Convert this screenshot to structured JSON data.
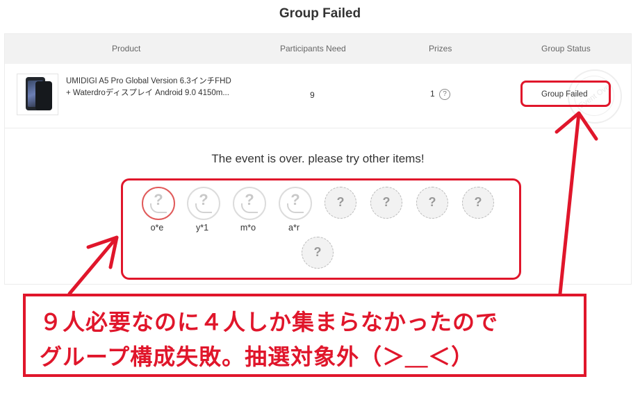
{
  "page": {
    "title": "Group Failed"
  },
  "table": {
    "headers": [
      "Product",
      "Participants Need",
      "Prizes",
      "Group Status"
    ],
    "row": {
      "product_line1": "UMIDIGI A5 Pro Global Version 6.3インチFHD",
      "product_line2": "+ Waterdroディスプレイ Android 9.0 4150m...",
      "participants_need": "9",
      "prizes": "1",
      "prizes_help": "?",
      "status": "Group Failed",
      "stamp": "Event Over"
    }
  },
  "event": {
    "message": "The event is over. please try other items!",
    "participants": [
      {
        "name": "o*e",
        "filled": true
      },
      {
        "name": "y*1",
        "filled": true
      },
      {
        "name": "m*o",
        "filled": true
      },
      {
        "name": "a*r",
        "filled": true
      },
      {
        "name": "",
        "filled": false
      },
      {
        "name": "",
        "filled": false
      },
      {
        "name": "",
        "filled": false
      },
      {
        "name": "",
        "filled": false
      },
      {
        "name": "",
        "filled": false
      }
    ],
    "empty_symbol": "?"
  },
  "annotation": {
    "line1": "９人必要なのに４人しか集まらなかったので",
    "line2": "グループ構成失敗。抽選対象外（＞＿＜）",
    "color": "#e0162b"
  }
}
